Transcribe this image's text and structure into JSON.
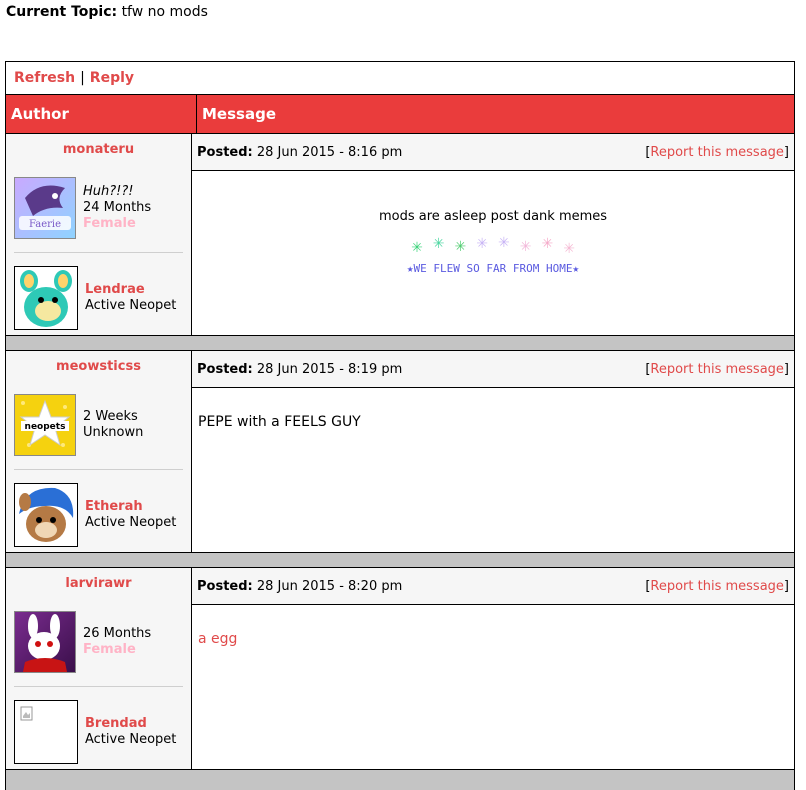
{
  "topic": {
    "label": "Current Topic:",
    "value": "tfw no mods"
  },
  "actions": {
    "refresh": "Refresh",
    "separator": "|",
    "reply": "Reply"
  },
  "header": {
    "author": "Author",
    "message": "Message"
  },
  "posted_label": "Posted:",
  "report": {
    "open": "[",
    "label": "Report this message",
    "close": "]"
  },
  "posts": [
    {
      "username": "monateru",
      "avatar_icon": "faerie-avatar-icon",
      "line1": "Huh?!?!",
      "line2": "24 Months",
      "gender": "Female",
      "pet_name": "Lendrae",
      "pet_status": "Active Neopet",
      "date": "28 Jun 2015 - 8:16 pm",
      "message": "mods are asleep post dank memes",
      "tagline": "★WE FLEW SO FAR FROM HOME★"
    },
    {
      "username": "meowsticss",
      "avatar_icon": "neopets-star-avatar-icon",
      "line1": "2 Weeks",
      "line2": "Unknown",
      "pet_name": "Etherah",
      "pet_status": "Active Neopet",
      "date": "28 Jun 2015 - 8:19 pm",
      "message": "PEPE with a FEELS GUY"
    },
    {
      "username": "larvirawr",
      "avatar_icon": "white-creature-avatar-icon",
      "line1": "26 Months",
      "gender": "Female",
      "pet_name": "Brendad",
      "pet_status": "Active Neopet",
      "date": "28 Jun 2015 - 8:20 pm",
      "message": "a egg"
    }
  ],
  "colors": {
    "header_red": "#ea3c3c",
    "link_red": "#e04a4a",
    "female_pink": "#ffb3c6",
    "tagline_blue": "#5a5ae0"
  }
}
